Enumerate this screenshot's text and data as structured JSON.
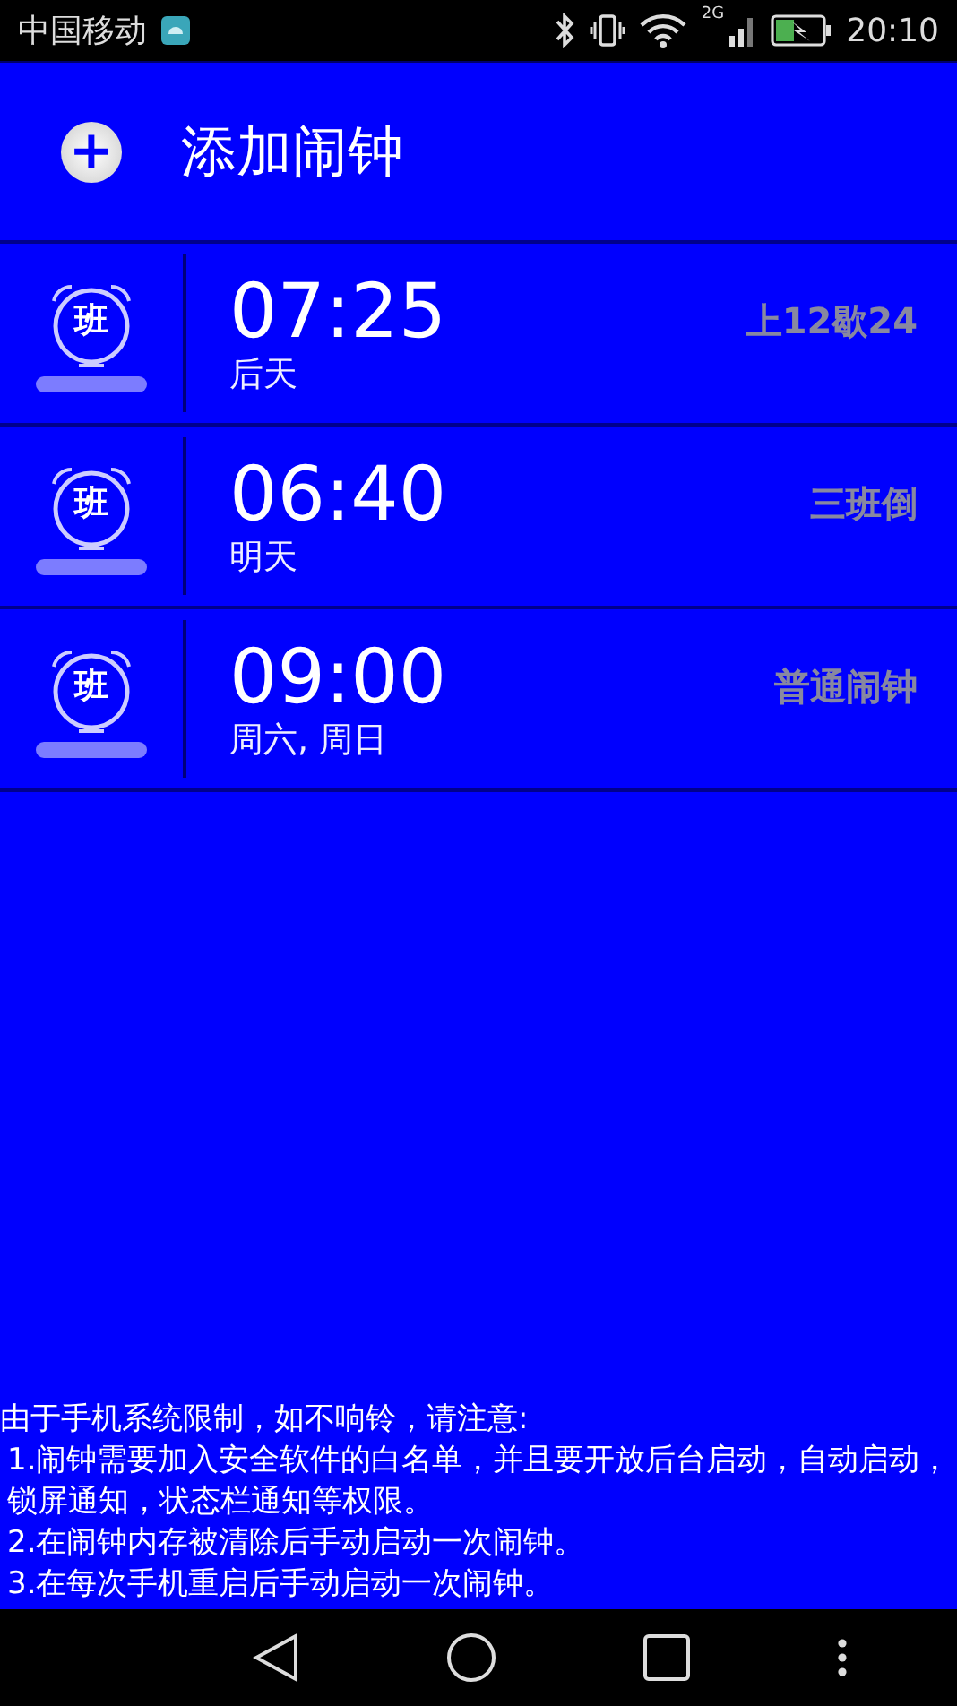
{
  "status_bar": {
    "carrier": "中国移动",
    "network": "2G",
    "time": "20:10"
  },
  "header": {
    "icon": "+",
    "title": "添加闹钟"
  },
  "alarms": [
    {
      "badge": "班",
      "time": "07:25",
      "days": "后天",
      "label": "上12歇24"
    },
    {
      "badge": "班",
      "time": "06:40",
      "days": "明天",
      "label": "三班倒"
    },
    {
      "badge": "班",
      "time": "09:00",
      "days": "周六, 周日",
      "label": "普通闹钟"
    }
  ],
  "notice": {
    "title": "由于手机系统限制，如不响铃，请注意:",
    "items": [
      "1.闹钟需要加入安全软件的白名单，并且要开放后台启动，自动启动，锁屏通知，状态栏通知等权限。",
      "2.在闹钟内存被清除后手动启动一次闹钟。",
      "3.在每次手机重启后手动启动一次闹钟。"
    ]
  }
}
